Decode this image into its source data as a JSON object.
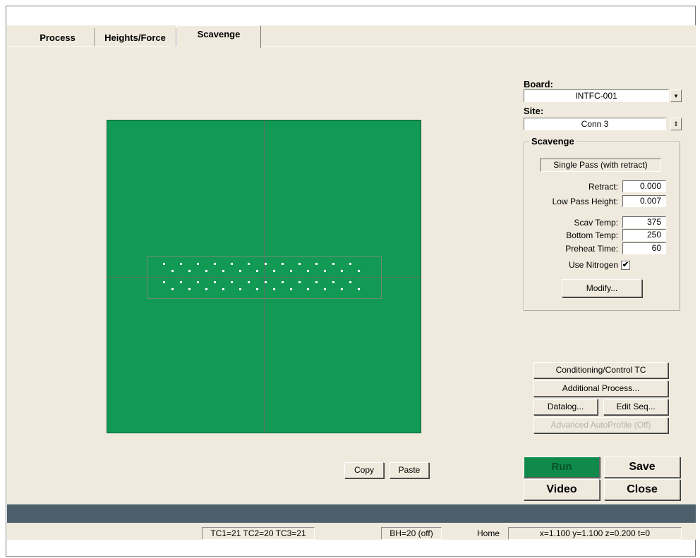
{
  "tabs": [
    "Process",
    "Heights/Force",
    "Scavenge"
  ],
  "board": {
    "label": "Board:",
    "value": "INTFC-001",
    "dropdown_glyph": "▾"
  },
  "site": {
    "label": "Site:",
    "value": "Conn 3",
    "spinner_glyph": "⇕"
  },
  "scavenge": {
    "title": "Scavenge",
    "mode": "Single Pass (with retract)",
    "retract_label": "Retract:",
    "retract": "0.000",
    "low_pass_label": "Low Pass Height:",
    "low_pass": "0.007",
    "scav_temp_label": "Scav Temp:",
    "scav_temp": "375",
    "bottom_temp_label": "Bottom Temp:",
    "bottom_temp": "250",
    "preheat_label": "Preheat Time:",
    "preheat": "60",
    "nitrogen_label": "Use Nitrogen",
    "nitrogen_checked": "✔",
    "modify": "Modify..."
  },
  "side_buttons": {
    "conditioning": "Conditioning/Control TC",
    "additional": "Additional Process...",
    "datalog": "Datalog...",
    "edit_seq": "Edit Seq...",
    "autoprofile": "Advanced AutoProfile (Off)"
  },
  "copy": "Copy",
  "paste": "Paste",
  "actions": {
    "run": "Run",
    "save": "Save",
    "video": "Video",
    "close": "Close"
  },
  "status": {
    "tc": "TC1=21 TC2=20 TC3=21",
    "bh": "BH=20 (off)",
    "home": "Home",
    "coords": "x=1.100 y=1.100 z=0.200 t=0"
  },
  "colors": {
    "board_green": "#129a54",
    "run_green": "#0f8a4a",
    "status_bar": "#4c5f6b",
    "background": "#efeadd"
  }
}
